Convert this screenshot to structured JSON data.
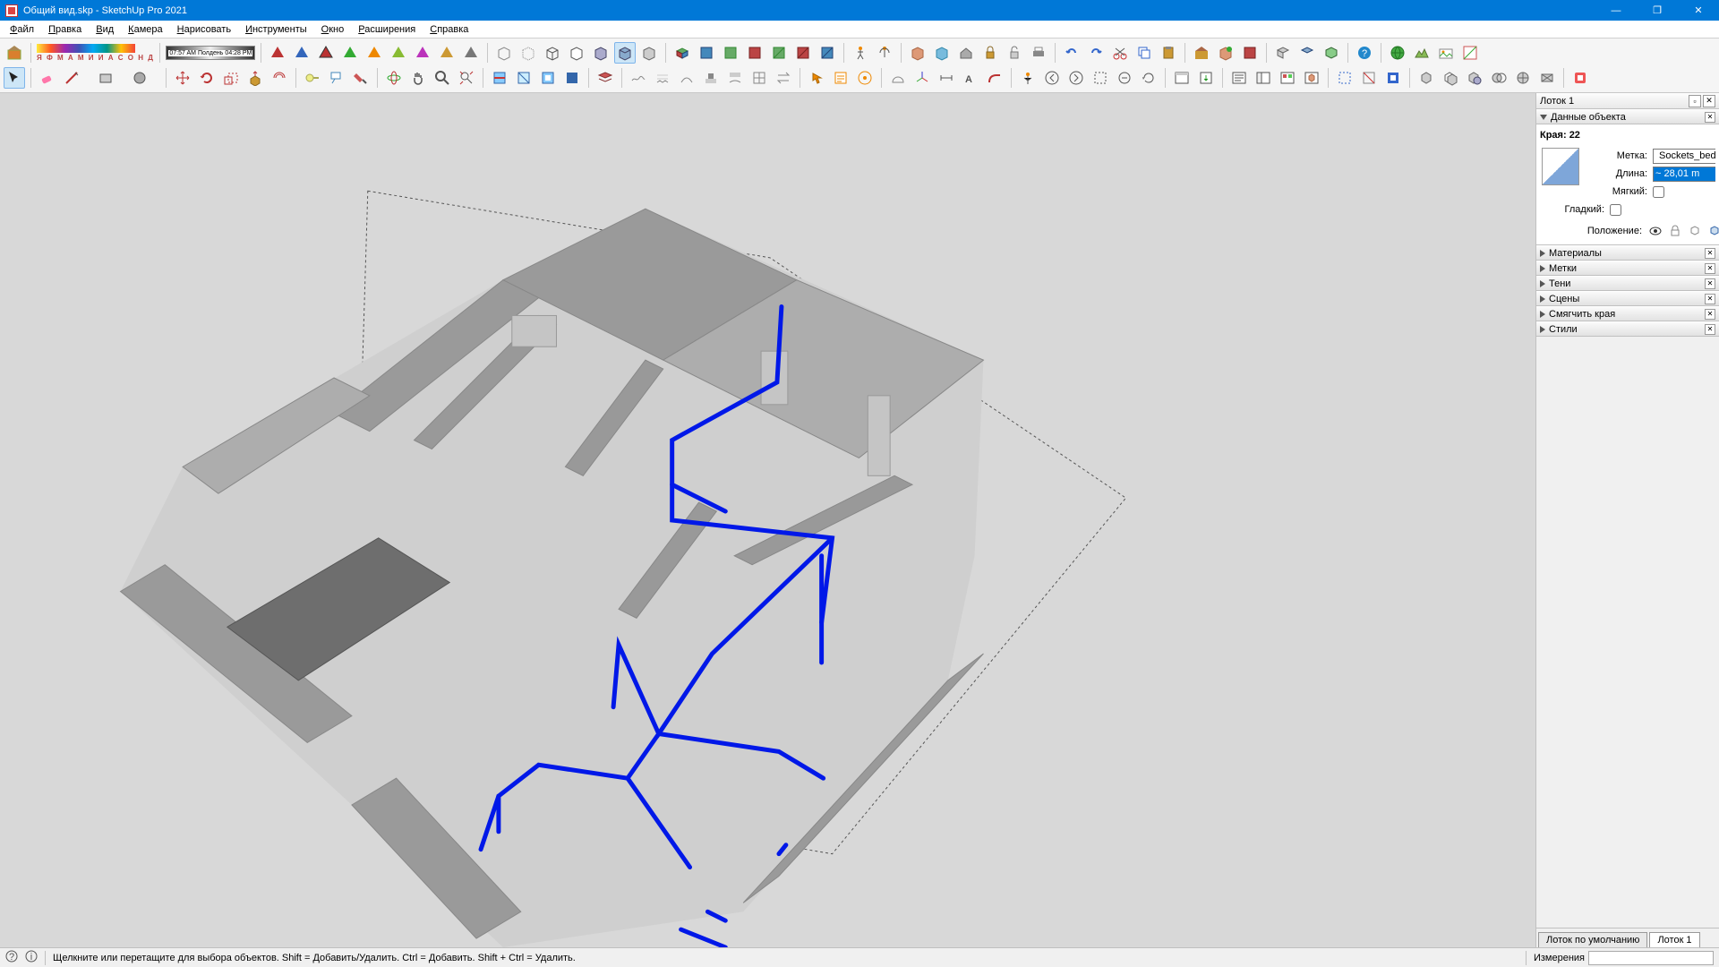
{
  "window": {
    "title": "Общий вид.skp - SketchUp Pro 2021",
    "minimize": "—",
    "maximize": "❐",
    "close": "✕"
  },
  "menu": [
    "Файл",
    "Правка",
    "Вид",
    "Камера",
    "Нарисовать",
    "Инструменты",
    "Окно",
    "Расширения",
    "Справка"
  ],
  "shadowbar": {
    "months": "Я Ф М А М И И А С О Н Д",
    "time_left": "07:57 AM",
    "time_mid": "Полдень",
    "time_right": "04:28 PM"
  },
  "tray": {
    "title": "Лоток 1",
    "panels": {
      "entity": "Данные объекта",
      "materials": "Материалы",
      "tags": "Метки",
      "shadows": "Тени",
      "scenes": "Сцены",
      "soften": "Смягчить края",
      "styles": "Стили"
    },
    "tabs": {
      "default": "Лоток по умолчанию",
      "tray1": "Лоток 1"
    }
  },
  "entity": {
    "heading": "Края: 22",
    "tag_label": "Метка:",
    "tag_value": "Sockets_bedroom",
    "length_label": "Длина:",
    "length_value": "~ 28,01 m",
    "soft_label": "Мягкий:",
    "smooth_label": "Гладкий:",
    "position_label": "Положение:"
  },
  "status": {
    "hint": "Щелкните или перетащите для выбора объектов. Shift = Добавить/Удалить. Ctrl = Добавить. Shift + Ctrl = Удалить.",
    "meas_label": "Измерения",
    "meas_value": ""
  }
}
